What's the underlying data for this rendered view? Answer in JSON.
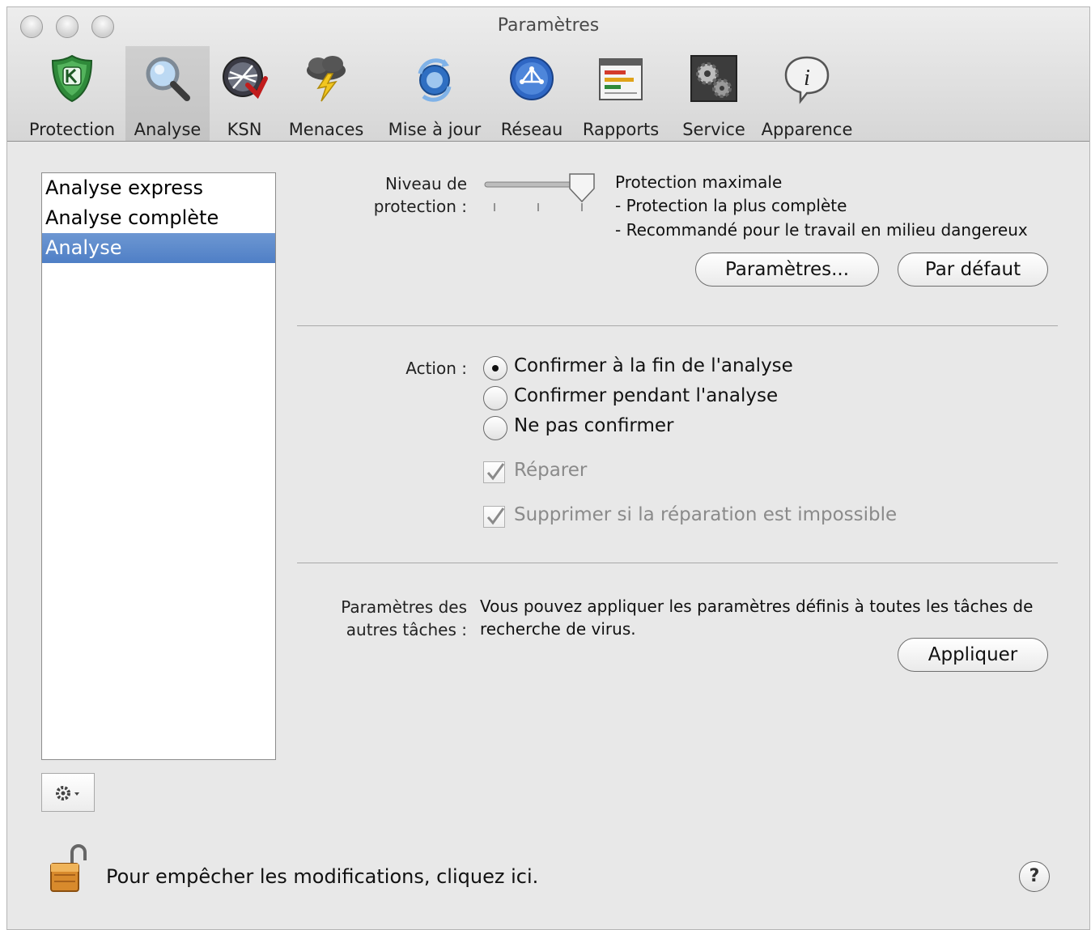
{
  "window": {
    "title": "Paramètres"
  },
  "toolbar": {
    "items": [
      {
        "label": "Protection",
        "icon": "kaspersky-shield-icon",
        "selected": false
      },
      {
        "label": "Analyse",
        "icon": "magnifier-icon",
        "selected": true
      },
      {
        "label": "KSN",
        "icon": "ksn-network-icon",
        "selected": false
      },
      {
        "label": "Menaces",
        "icon": "storm-cloud-icon",
        "selected": false
      },
      {
        "label": "Mise à jour",
        "icon": "update-sync-icon",
        "selected": false
      },
      {
        "label": "Réseau",
        "icon": "network-globe-icon",
        "selected": false
      },
      {
        "label": "Rapports",
        "icon": "reports-chart-icon",
        "selected": false
      },
      {
        "label": "Service",
        "icon": "service-gears-icon",
        "selected": false
      },
      {
        "label": "Apparence",
        "icon": "info-bubble-icon",
        "selected": false
      }
    ]
  },
  "sidebar": {
    "items": [
      {
        "label": "Analyse express",
        "selected": false
      },
      {
        "label": "Analyse complète",
        "selected": false
      },
      {
        "label": "Analyse",
        "selected": true
      }
    ]
  },
  "protection": {
    "label_line1": "Niveau de",
    "label_line2": "protection :",
    "slider_level": 3,
    "slider_max": 3,
    "desc_title": "Protection maximale",
    "desc_line1": "- Protection la plus complète",
    "desc_line2": "- Recommandé pour le travail en milieu dangereux",
    "settings_button": "Paramètres...",
    "default_button": "Par défaut"
  },
  "action": {
    "label": "Action :",
    "options": [
      {
        "label": "Confirmer à la fin de l'analyse",
        "checked": true
      },
      {
        "label": "Confirmer pendant l'analyse",
        "checked": false
      },
      {
        "label": "Ne pas confirmer",
        "checked": false
      }
    ],
    "repair_label": "Réparer",
    "delete_label": "Supprimer si la réparation est impossible"
  },
  "other_tasks": {
    "label_line1": "Paramètres des",
    "label_line2": "autres tâches :",
    "text_line1": "Vous pouvez appliquer les paramètres définis à toutes les tâches de",
    "text_line2": "recherche de virus.",
    "apply_button": "Appliquer"
  },
  "footer": {
    "lock_text": "Pour empêcher les modifications, cliquez ici.",
    "help_label": "?"
  }
}
